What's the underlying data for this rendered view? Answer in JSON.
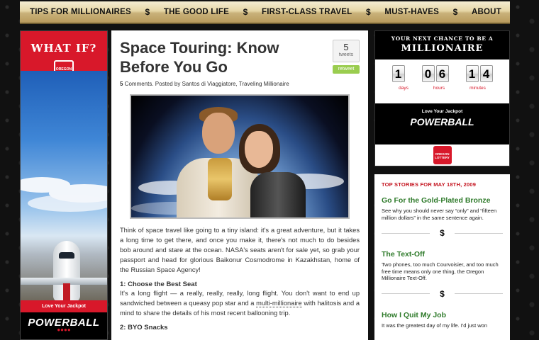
{
  "nav": {
    "items": [
      "TIPS FOR MILLIONAIRES",
      "THE GOOD LIFE",
      "FIRST-CLASS TRAVEL",
      "MUST-HAVES",
      "ABOUT"
    ],
    "separator": "$"
  },
  "left_ad": {
    "headline": "WHAT IF?",
    "logo_text": "OREGON LOTTERY",
    "tagline": "Love Your Jackpot",
    "brand": "POWERBALL",
    "dots": "●●●●"
  },
  "post": {
    "title": "Space Touring: Know Before You Go",
    "tweet_count": "5",
    "tweet_label": "tweets",
    "retweet_label": "retweet",
    "comments_count": "5",
    "meta_text": " Comments. Posted by Santos di Viaggiatore, Traveling Millionaire",
    "intro": "Think of space travel like going to a tiny island: it's a great adventure, but it takes a long time to get there, and once you make it, there's not much to do besides bob around and stare at the ocean. NASA's seats aren't for sale yet, so grab your passport and head for glorious Baikonur Cosmodrome in Kazakhstan, home of the Russian Space Agency!",
    "section1_heading": "1: Choose the Best Seat",
    "section1_before_link": "It's a long flight — a really, really, really, long flight. You don't want to end up sandwiched between a queasy pop star and a ",
    "section1_link": "multi-millionaire",
    "section1_after_link": " with halitosis and a mind to share the details of his most recent ballooning trip.",
    "section2_heading": "2: BYO Snacks"
  },
  "right_ad": {
    "line1": "YOUR NEXT CHANCE TO BE A",
    "line2": "MILLIONAIRE",
    "days": "1",
    "hours": [
      "0",
      "6"
    ],
    "minutes": [
      "1",
      "4"
    ],
    "days_label": "days",
    "hours_label": "hours",
    "minutes_label": "minutes",
    "tagline": "Love Your Jackpot",
    "brand": "POWERBALL",
    "logo_text": "OREGON LOTTERY"
  },
  "stories": {
    "heading": "TOP STORIES FOR MAY 18TH, 2009",
    "separator": "$",
    "items": [
      {
        "title": "Go For the Gold-Plated Bronze",
        "text": "See why you should never say “only” and “fifteen million dollars” in the same sentence again."
      },
      {
        "title": "The Text-Off",
        "text": "Two phones, too much Courvoisier, and too much free time means only one thing, the Oregon Millionaire Text-Off."
      },
      {
        "title": "How I Quit My Job",
        "text": "It was the greatest day of my life. I'd just won"
      }
    ]
  }
}
